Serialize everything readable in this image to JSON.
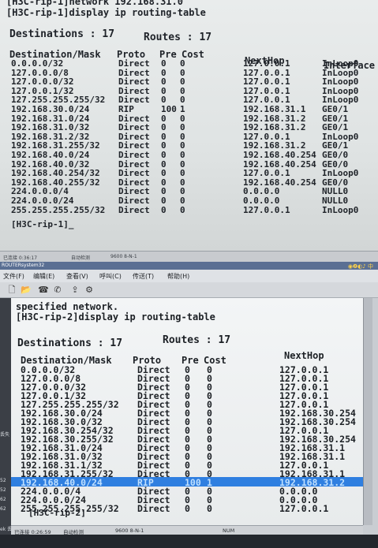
{
  "window1": {
    "cmd_line_1": "[H3C-rip-1]network 192.168.31.0",
    "cmd_line_2": "[H3C-rip-1]display ip routing-table",
    "destinations": "Destinations : 17",
    "routes": "Routes : 17",
    "headers": {
      "dest": "Destination/Mask",
      "proto": "Proto",
      "pre": "Pre",
      "cost": "Cost",
      "nexthop": "NextHop",
      "iface": "Interface"
    },
    "rows": [
      {
        "dest": "0.0.0.0/32",
        "proto": "Direct",
        "pre": "0",
        "cost": "0",
        "nexthop": "127.0.0.1",
        "iface": "InLoop0"
      },
      {
        "dest": "127.0.0.0/8",
        "proto": "Direct",
        "pre": "0",
        "cost": "0",
        "nexthop": "127.0.0.1",
        "iface": "InLoop0"
      },
      {
        "dest": "127.0.0.0/32",
        "proto": "Direct",
        "pre": "0",
        "cost": "0",
        "nexthop": "127.0.0.1",
        "iface": "InLoop0"
      },
      {
        "dest": "127.0.0.1/32",
        "proto": "Direct",
        "pre": "0",
        "cost": "0",
        "nexthop": "127.0.0.1",
        "iface": "InLoop0"
      },
      {
        "dest": "127.255.255.255/32",
        "proto": "Direct",
        "pre": "0",
        "cost": "0",
        "nexthop": "127.0.0.1",
        "iface": "InLoop0"
      },
      {
        "dest": "192.168.30.0/24",
        "proto": "RIP",
        "pre": "100",
        "cost": "1",
        "nexthop": "192.168.31.1",
        "iface": "GE0/1"
      },
      {
        "dest": "192.168.31.0/24",
        "proto": "Direct",
        "pre": "0",
        "cost": "0",
        "nexthop": "192.168.31.2",
        "iface": "GE0/1"
      },
      {
        "dest": "192.168.31.0/32",
        "proto": "Direct",
        "pre": "0",
        "cost": "0",
        "nexthop": "192.168.31.2",
        "iface": "GE0/1"
      },
      {
        "dest": "192.168.31.2/32",
        "proto": "Direct",
        "pre": "0",
        "cost": "0",
        "nexthop": "127.0.0.1",
        "iface": "InLoop0"
      },
      {
        "dest": "192.168.31.255/32",
        "proto": "Direct",
        "pre": "0",
        "cost": "0",
        "nexthop": "192.168.31.2",
        "iface": "GE0/1"
      },
      {
        "dest": "192.168.40.0/24",
        "proto": "Direct",
        "pre": "0",
        "cost": "0",
        "nexthop": "192.168.40.254",
        "iface": "GE0/0"
      },
      {
        "dest": "192.168.40.0/32",
        "proto": "Direct",
        "pre": "0",
        "cost": "0",
        "nexthop": "192.168.40.254",
        "iface": "GE0/0"
      },
      {
        "dest": "192.168.40.254/32",
        "proto": "Direct",
        "pre": "0",
        "cost": "0",
        "nexthop": "127.0.0.1",
        "iface": "InLoop0"
      },
      {
        "dest": "192.168.40.255/32",
        "proto": "Direct",
        "pre": "0",
        "cost": "0",
        "nexthop": "192.168.40.254",
        "iface": "GE0/0"
      },
      {
        "dest": "224.0.0.0/4",
        "proto": "Direct",
        "pre": "0",
        "cost": "0",
        "nexthop": "0.0.0.0",
        "iface": "NULL0"
      },
      {
        "dest": "224.0.0.0/24",
        "proto": "Direct",
        "pre": "0",
        "cost": "0",
        "nexthop": "0.0.0.0",
        "iface": "NULL0"
      },
      {
        "dest": "255.255.255.255/32",
        "proto": "Direct",
        "pre": "0",
        "cost": "0",
        "nexthop": "127.0.0.1",
        "iface": "InLoop0"
      }
    ],
    "prompt": "[H3C-rip-1]_",
    "status": {
      "left": "已连接 0:36:17",
      "middle": "自动检测",
      "speed": "9600 8-N-1"
    },
    "taskbar_item": "ROUTERsystem32",
    "tray_text": "◉❷◐♪ 中"
  },
  "window2": {
    "menu": [
      "文件(F)",
      "编辑(E)",
      "查看(V)",
      "呼叫(C)",
      "传送(T)",
      "帮助(H)"
    ],
    "toolbar_icons": [
      "new-icon",
      "open-icon",
      "phone-icon",
      "disconnect-icon",
      "send-icon",
      "properties-icon"
    ],
    "toolbar_glyphs": [
      "🗋",
      "📂",
      "☎",
      "✆",
      "⇪",
      "⚙"
    ],
    "line_1": "specified network.",
    "line_2": "[H3C-rip-2]display ip routing-table",
    "destinations": "Destinations : 17",
    "routes": "Routes : 17",
    "headers": {
      "dest": "Destination/Mask",
      "proto": "Proto",
      "pre": "Pre",
      "cost": "Cost",
      "nexthop": "NextHop"
    },
    "rows": [
      {
        "dest": "0.0.0.0/32",
        "proto": "Direct",
        "pre": "0",
        "cost": "0",
        "nexthop": "127.0.0.1"
      },
      {
        "dest": "127.0.0.0/8",
        "proto": "Direct",
        "pre": "0",
        "cost": "0",
        "nexthop": "127.0.0.1"
      },
      {
        "dest": "127.0.0.0/32",
        "proto": "Direct",
        "pre": "0",
        "cost": "0",
        "nexthop": "127.0.0.1"
      },
      {
        "dest": "127.0.0.1/32",
        "proto": "Direct",
        "pre": "0",
        "cost": "0",
        "nexthop": "127.0.0.1"
      },
      {
        "dest": "127.255.255.255/32",
        "proto": "Direct",
        "pre": "0",
        "cost": "0",
        "nexthop": "127.0.0.1"
      },
      {
        "dest": "192.168.30.0/24",
        "proto": "Direct",
        "pre": "0",
        "cost": "0",
        "nexthop": "192.168.30.254"
      },
      {
        "dest": "192.168.30.0/32",
        "proto": "Direct",
        "pre": "0",
        "cost": "0",
        "nexthop": "192.168.30.254"
      },
      {
        "dest": "192.168.30.254/32",
        "proto": "Direct",
        "pre": "0",
        "cost": "0",
        "nexthop": "127.0.0.1"
      },
      {
        "dest": "192.168.30.255/32",
        "proto": "Direct",
        "pre": "0",
        "cost": "0",
        "nexthop": "192.168.30.254"
      },
      {
        "dest": "192.168.31.0/24",
        "proto": "Direct",
        "pre": "0",
        "cost": "0",
        "nexthop": "192.168.31.1"
      },
      {
        "dest": "192.168.31.0/32",
        "proto": "Direct",
        "pre": "0",
        "cost": "0",
        "nexthop": "192.168.31.1"
      },
      {
        "dest": "192.168.31.1/32",
        "proto": "Direct",
        "pre": "0",
        "cost": "0",
        "nexthop": "127.0.0.1"
      },
      {
        "dest": "192.168.31.255/32",
        "proto": "Direct",
        "pre": "0",
        "cost": "0",
        "nexthop": "192.168.31.1"
      },
      {
        "dest": "192.168.40.0/24",
        "proto": "RIP",
        "pre": "100",
        "cost": "1",
        "nexthop": "192.168.31.2"
      },
      {
        "dest": "224.0.0.0/4",
        "proto": "Direct",
        "pre": "0",
        "cost": "0",
        "nexthop": "0.0.0.0"
      },
      {
        "dest": "224.0.0.0/24",
        "proto": "Direct",
        "pre": "0",
        "cost": "0",
        "nexthop": "0.0.0.0"
      },
      {
        "dest": "255.255.255.255/32",
        "proto": "Direct",
        "pre": "0",
        "cost": "0",
        "nexthop": "127.0.0.1"
      }
    ],
    "highlight_row": 13,
    "prompt": "[H3C-rip-2]",
    "status": {
      "left": "已连接 0:26:59",
      "middle": "自动检测",
      "speed": "9600 8-N-1",
      "num": "NUM"
    },
    "side_labels": [
      "丢失",
      "52",
      "52",
      "62",
      "62",
      "ek 丢失"
    ]
  },
  "colors": {
    "highlight_bg": "#2f7fe0",
    "highlight_fg": "#bfe0ff",
    "terminal_text": "#1c2025"
  }
}
